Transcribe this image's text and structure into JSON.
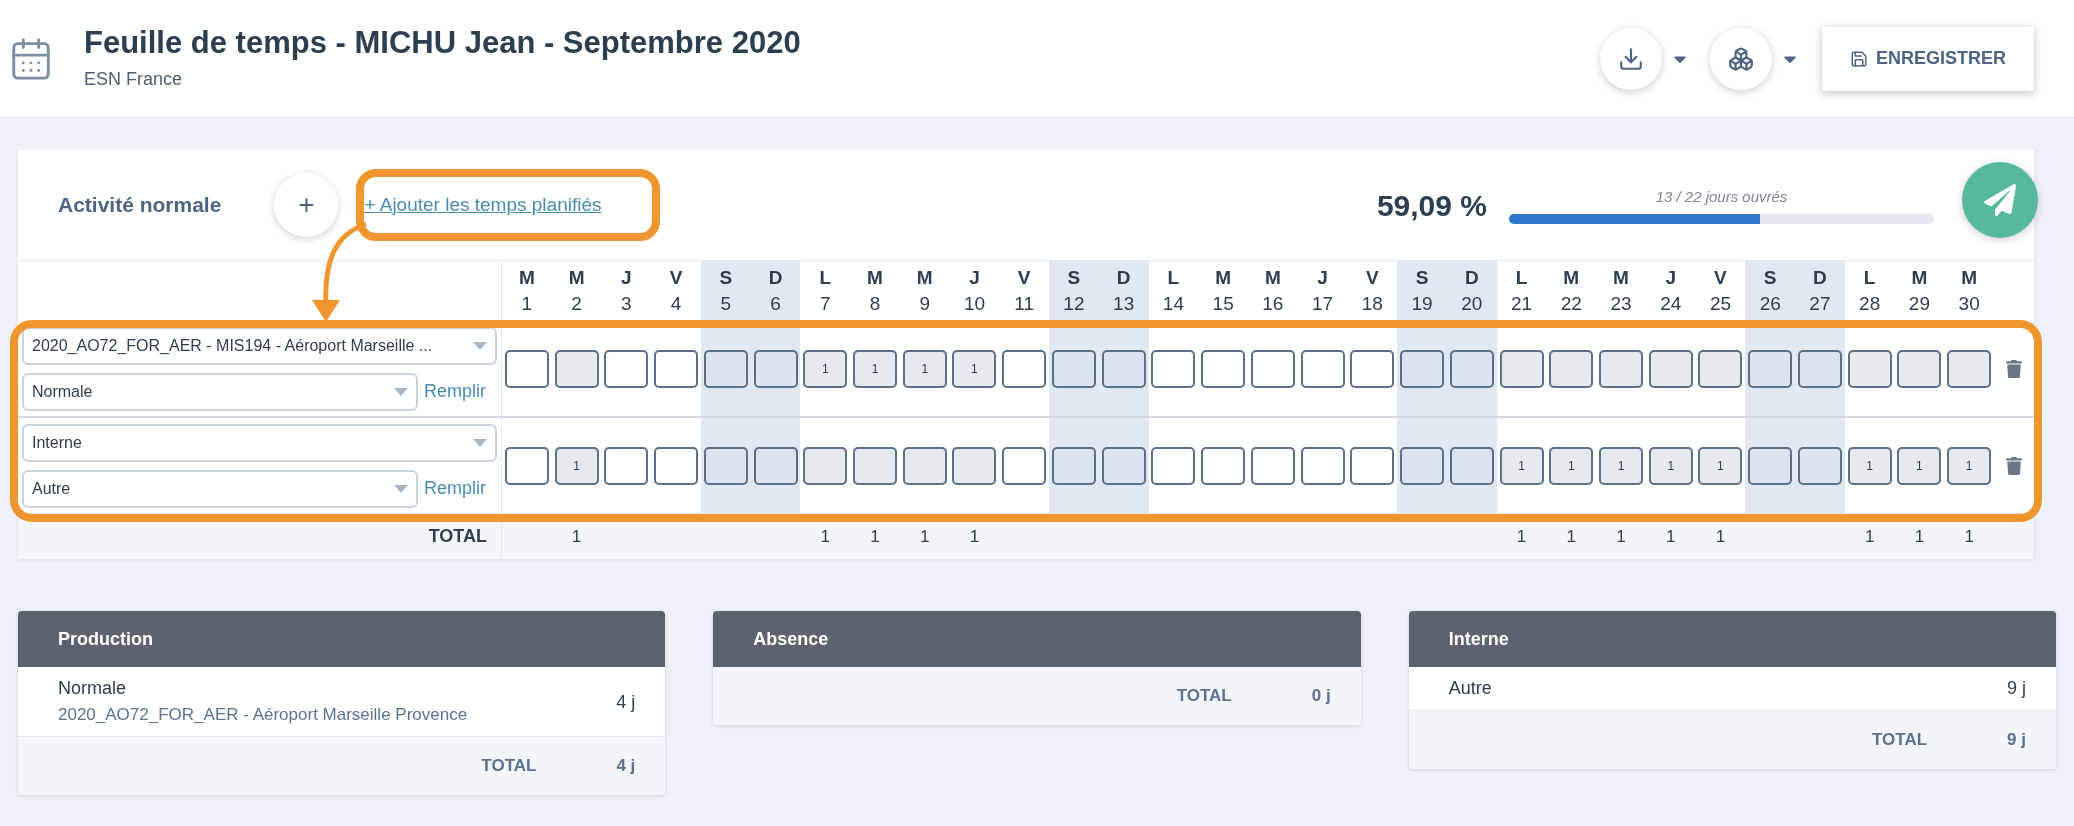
{
  "header": {
    "title": "Feuille de temps - MICHU Jean - Septembre 2020",
    "subtitle": "ESN France",
    "save_button": "ENREGISTRER"
  },
  "activity": {
    "title": "Activité normale",
    "add_button": "+",
    "add_planned_link": "+ Ajouter les temps planifiés",
    "highlighted": true,
    "percent": "59,09 %",
    "progress_caption": "13 / 22 jours ouvrés",
    "level": 0.59
  },
  "days": [
    {
      "letter": "M",
      "number": "1",
      "weekend": false
    },
    {
      "letter": "M",
      "number": "2",
      "weekend": false,
      "total": "1"
    },
    {
      "letter": "J",
      "number": "3",
      "weekend": false
    },
    {
      "letter": "V",
      "number": "4",
      "weekend": false
    },
    {
      "letter": "S",
      "number": "5",
      "weekend": true
    },
    {
      "letter": "D",
      "number": "6",
      "weekend": true
    },
    {
      "letter": "L",
      "number": "7",
      "weekend": false,
      "total": "1"
    },
    {
      "letter": "M",
      "number": "8",
      "weekend": false,
      "total": "1"
    },
    {
      "letter": "M",
      "number": "9",
      "weekend": false,
      "total": "1"
    },
    {
      "letter": "J",
      "number": "10",
      "weekend": false,
      "total": "1"
    },
    {
      "letter": "V",
      "number": "11",
      "weekend": false
    },
    {
      "letter": "S",
      "number": "12",
      "weekend": true
    },
    {
      "letter": "D",
      "number": "13",
      "weekend": true
    },
    {
      "letter": "L",
      "number": "14",
      "weekend": false
    },
    {
      "letter": "M",
      "number": "15",
      "weekend": false
    },
    {
      "letter": "M",
      "number": "16",
      "weekend": false
    },
    {
      "letter": "J",
      "number": "17",
      "weekend": false
    },
    {
      "letter": "V",
      "number": "18",
      "weekend": false
    },
    {
      "letter": "S",
      "number": "19",
      "weekend": true
    },
    {
      "letter": "D",
      "number": "20",
      "weekend": true
    },
    {
      "letter": "L",
      "number": "21",
      "weekend": false,
      "total": "1"
    },
    {
      "letter": "M",
      "number": "22",
      "weekend": false,
      "total": "1"
    },
    {
      "letter": "M",
      "number": "23",
      "weekend": false,
      "total": "1"
    },
    {
      "letter": "J",
      "number": "24",
      "weekend": false,
      "total": "1"
    },
    {
      "letter": "V",
      "number": "25",
      "weekend": false,
      "total": "1"
    },
    {
      "letter": "S",
      "number": "26",
      "weekend": true
    },
    {
      "letter": "D",
      "number": "27",
      "weekend": true
    },
    {
      "letter": "L",
      "number": "28",
      "weekend": false,
      "total": "1"
    },
    {
      "letter": "M",
      "number": "29",
      "weekend": false,
      "total": "1"
    },
    {
      "letter": "M",
      "number": "30",
      "weekend": false,
      "total": "1"
    }
  ],
  "rows_highlighted": true,
  "rows": [
    {
      "project": "2020_AO72_FOR_AER - MIS194 - Aéroport Marseille ...",
      "type": "Normale",
      "fill_link": "Remplir",
      "cells": [
        {
          "kind": "open"
        },
        {
          "kind": "planned"
        },
        {
          "kind": "open"
        },
        {
          "kind": "open"
        },
        {
          "kind": "weekend"
        },
        {
          "kind": "weekend"
        },
        {
          "kind": "planned",
          "value": "1"
        },
        {
          "kind": "planned",
          "value": "1"
        },
        {
          "kind": "planned",
          "value": "1"
        },
        {
          "kind": "planned",
          "value": "1"
        },
        {
          "kind": "open"
        },
        {
          "kind": "weekend"
        },
        {
          "kind": "weekend"
        },
        {
          "kind": "open"
        },
        {
          "kind": "open"
        },
        {
          "kind": "open"
        },
        {
          "kind": "open"
        },
        {
          "kind": "open"
        },
        {
          "kind": "weekend"
        },
        {
          "kind": "weekend"
        },
        {
          "kind": "planned"
        },
        {
          "kind": "planned"
        },
        {
          "kind": "planned"
        },
        {
          "kind": "planned"
        },
        {
          "kind": "planned"
        },
        {
          "kind": "weekend"
        },
        {
          "kind": "weekend"
        },
        {
          "kind": "planned"
        },
        {
          "kind": "planned"
        },
        {
          "kind": "planned"
        }
      ]
    },
    {
      "project": "Interne",
      "type": "Autre",
      "fill_link": "Remplir",
      "cells": [
        {
          "kind": "open"
        },
        {
          "kind": "planned",
          "value": "1"
        },
        {
          "kind": "open"
        },
        {
          "kind": "open"
        },
        {
          "kind": "weekend"
        },
        {
          "kind": "weekend"
        },
        {
          "kind": "planned"
        },
        {
          "kind": "planned"
        },
        {
          "kind": "planned"
        },
        {
          "kind": "planned"
        },
        {
          "kind": "open"
        },
        {
          "kind": "weekend"
        },
        {
          "kind": "weekend"
        },
        {
          "kind": "open"
        },
        {
          "kind": "open"
        },
        {
          "kind": "open"
        },
        {
          "kind": "open"
        },
        {
          "kind": "open"
        },
        {
          "kind": "weekend"
        },
        {
          "kind": "weekend"
        },
        {
          "kind": "planned",
          "value": "1"
        },
        {
          "kind": "planned",
          "value": "1"
        },
        {
          "kind": "planned",
          "value": "1"
        },
        {
          "kind": "planned",
          "value": "1"
        },
        {
          "kind": "planned",
          "value": "1"
        },
        {
          "kind": "weekend"
        },
        {
          "kind": "weekend"
        },
        {
          "kind": "planned",
          "value": "1"
        },
        {
          "kind": "planned",
          "value": "1"
        },
        {
          "kind": "planned",
          "value": "1"
        }
      ]
    }
  ],
  "total_label": "TOTAL",
  "summaries": [
    {
      "title": "Production",
      "entries": [
        {
          "label": "Normale",
          "detail": "2020_AO72_FOR_AER - Aéroport Marseille Provence",
          "value": "4 j"
        }
      ],
      "total_label": "TOTAL",
      "total": "4 j"
    },
    {
      "title": "Absence",
      "total_label": "TOTAL",
      "total": "0 j"
    },
    {
      "title": "Interne",
      "entries": [
        {
          "label": "Autre",
          "value": "9 j"
        }
      ],
      "total_label": "TOTAL",
      "total": "9 j"
    }
  ]
}
